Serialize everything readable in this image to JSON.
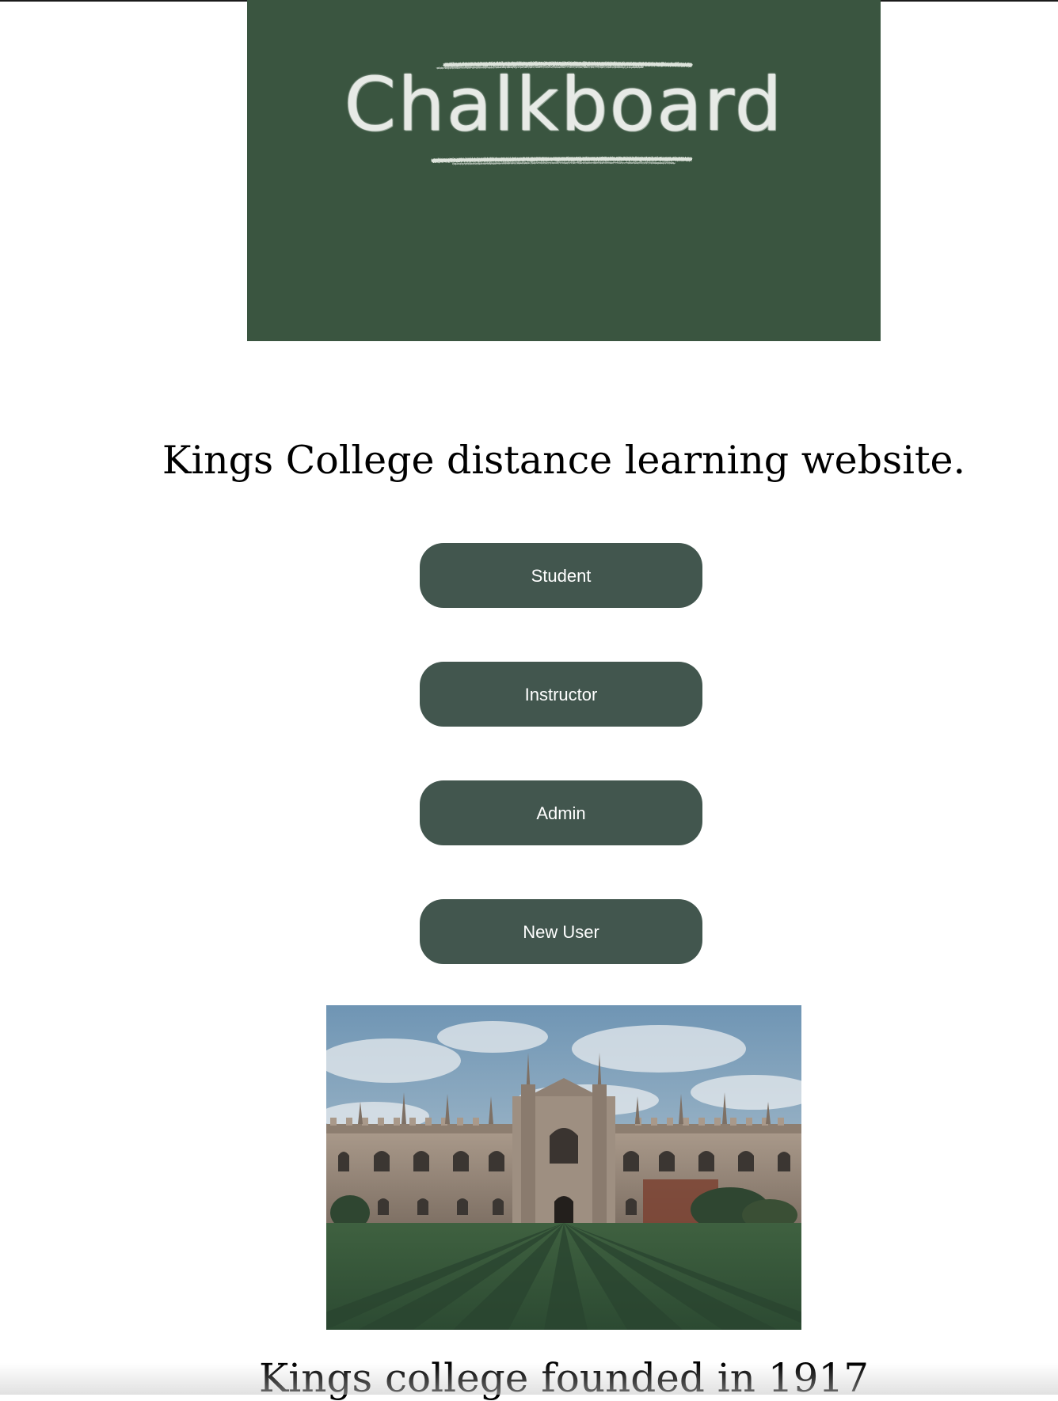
{
  "logo": {
    "text": "Chalkboard",
    "background_color": "#3a5540"
  },
  "tagline": "Kings College distance learning website.",
  "buttons": [
    {
      "label": "Student"
    },
    {
      "label": "Instructor"
    },
    {
      "label": "Admin"
    },
    {
      "label": "New User"
    }
  ],
  "button_color": "#42564e",
  "photo": {
    "subject": "college-building-photo"
  },
  "caption": "Kings college founded in 1917"
}
